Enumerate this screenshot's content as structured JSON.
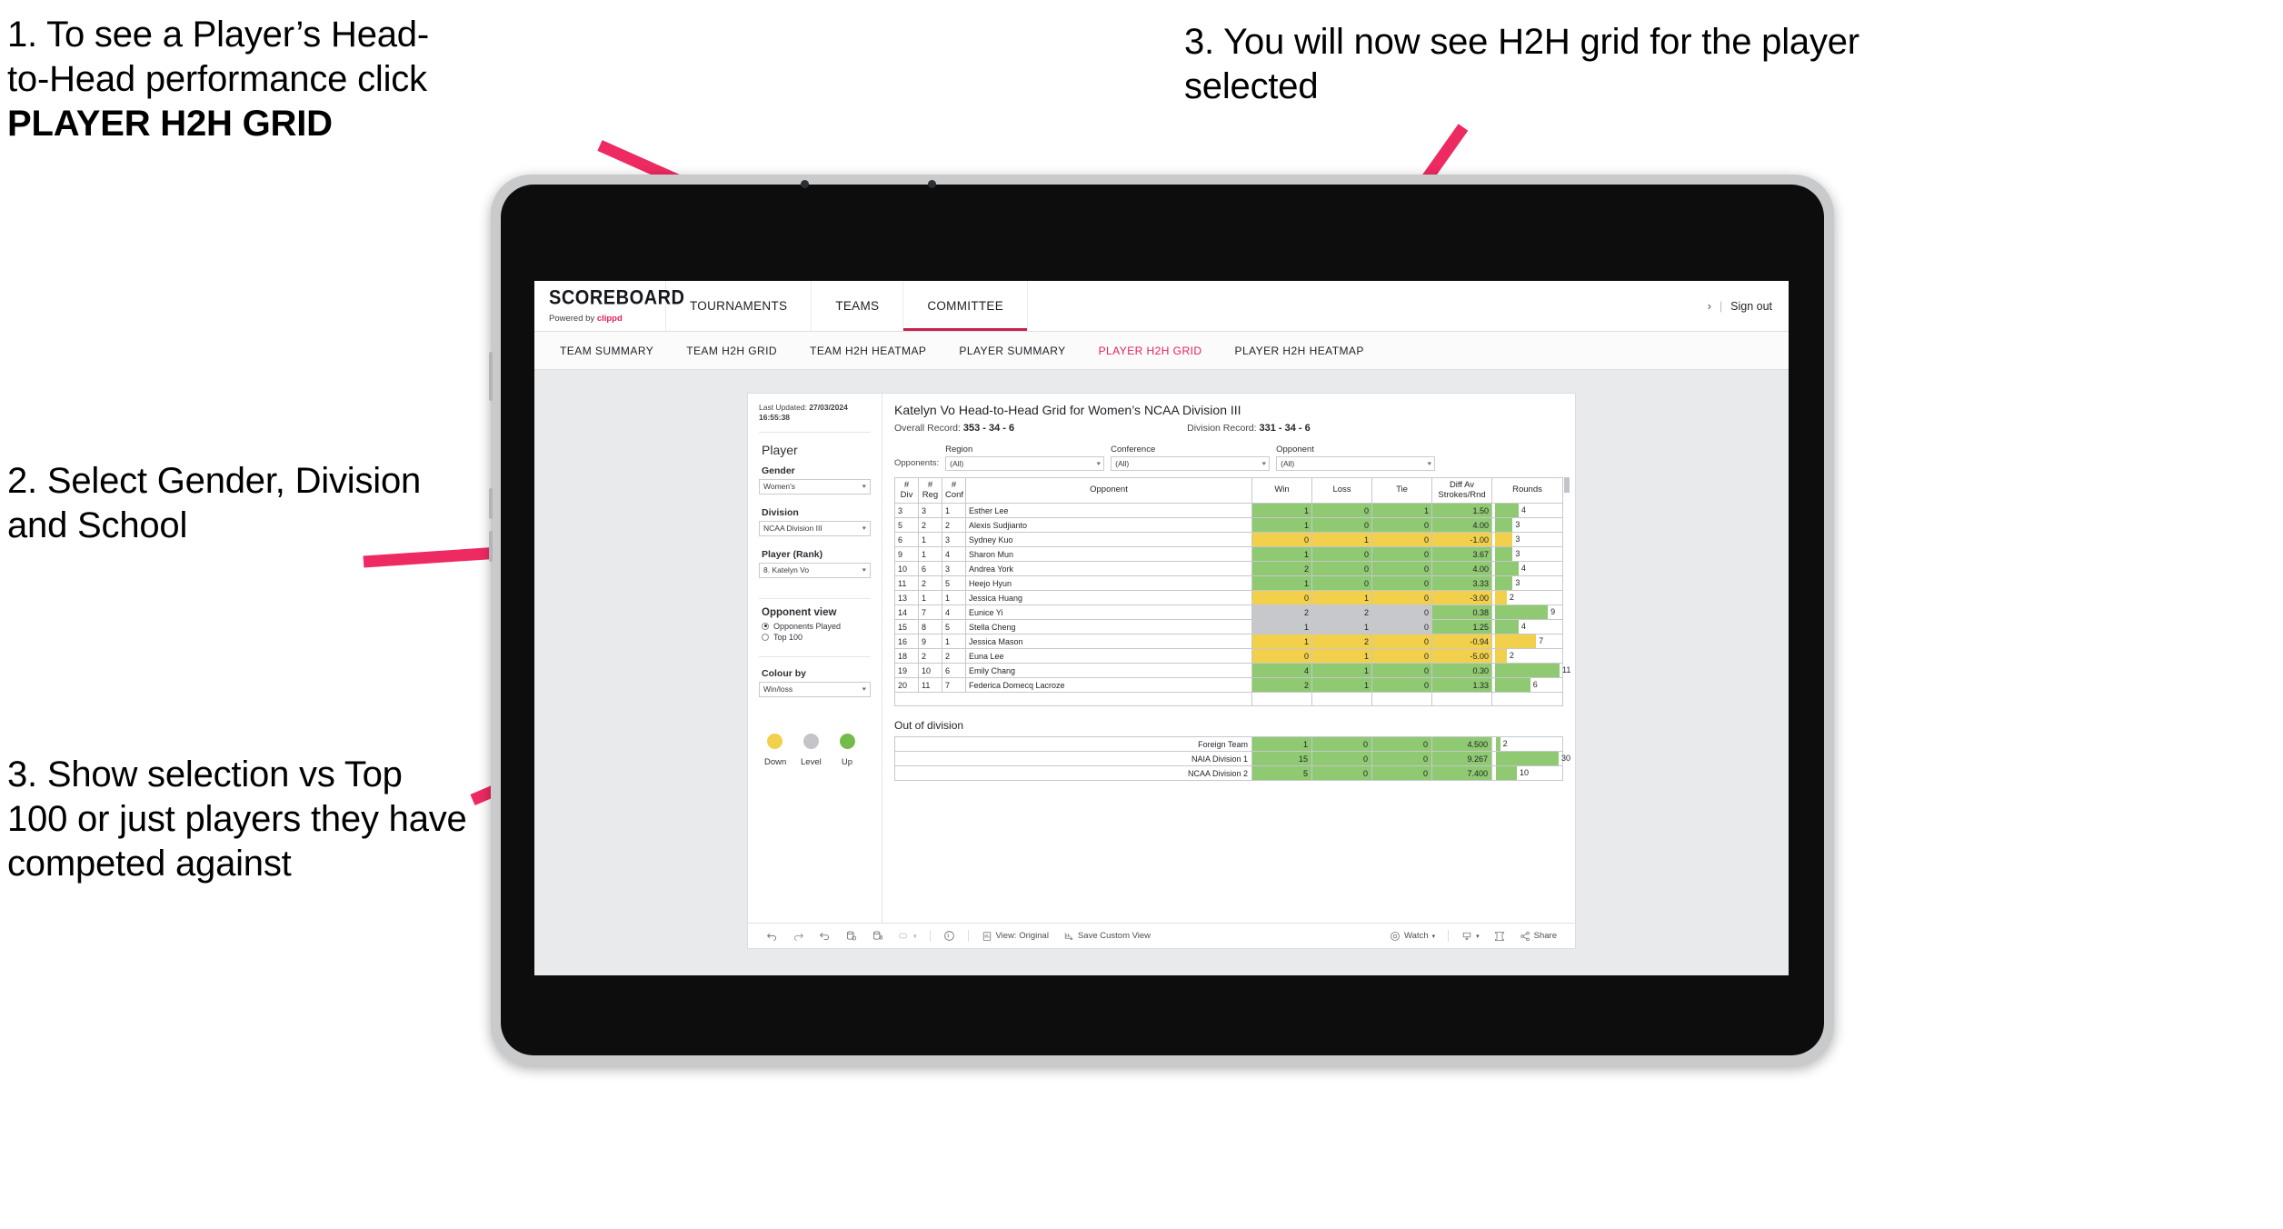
{
  "annotations": [
    {
      "id": "anno-1",
      "line1": "1. To see a Player’s Head-",
      "line2": "to-Head performance click",
      "bold": "PLAYER H2H GRID"
    },
    {
      "id": "anno-2",
      "text": "2. Select Gender, Division and School"
    },
    {
      "id": "anno-3",
      "text": "3. Show selection vs Top 100 or just players they have competed against"
    },
    {
      "id": "anno-4",
      "text": "3. You will now see H2H grid for the player selected"
    }
  ],
  "colors": {
    "accent": "#e8205a",
    "arrow": "#ee2a62",
    "green": "#8fc971",
    "yellow": "#f2d04b",
    "grey": "#c6c8cb",
    "bezel": "#c9cacb"
  },
  "app": {
    "brand": {
      "title": "SCOREBOARD",
      "powered_prefix": "Powered by ",
      "powered_brand": "clippd"
    },
    "topnav": [
      {
        "label": "TOURNAMENTS",
        "active": false
      },
      {
        "label": "TEAMS",
        "active": false
      },
      {
        "label": "COMMITTEE",
        "active": true
      }
    ],
    "topbar_right": {
      "chevron": "›",
      "divider": "|",
      "signout": "Sign out"
    },
    "subnav": [
      {
        "label": "TEAM SUMMARY",
        "active": false
      },
      {
        "label": "TEAM H2H GRID",
        "active": false
      },
      {
        "label": "TEAM H2H HEATMAP",
        "active": false
      },
      {
        "label": "PLAYER SUMMARY",
        "active": false
      },
      {
        "label": "PLAYER H2H GRID",
        "active": true
      },
      {
        "label": "PLAYER H2H HEATMAP",
        "active": false
      }
    ]
  },
  "pane": {
    "last_updated_label": "Last Updated: ",
    "last_updated_value": "27/03/2024 16:55:38",
    "heading": "Player",
    "filters": [
      {
        "label": "Gender",
        "value": "Women's"
      },
      {
        "label": "Division",
        "value": "NCAA Division III"
      },
      {
        "label": "Player (Rank)",
        "value": "8. Katelyn Vo"
      }
    ],
    "opponent_view": {
      "heading": "Opponent view",
      "options": [
        {
          "label": "Opponents Played",
          "selected": true
        },
        {
          "label": "Top 100",
          "selected": false
        }
      ]
    },
    "colour_by": {
      "label": "Colour by",
      "value": "Win/loss"
    },
    "legend": [
      {
        "label": "Down",
        "color": "#f2d04b"
      },
      {
        "label": "Level",
        "color": "#c3c5c8"
      },
      {
        "label": "Up",
        "color": "#74bb4e"
      }
    ]
  },
  "main": {
    "title": "Katelyn Vo Head-to-Head Grid for Women’s NCAA Division III",
    "overall_record_label": "Overall Record: ",
    "overall_record_value": "353 -  34 - 6",
    "division_record_label": "Division Record: ",
    "division_record_value": "331 -  34 - 6",
    "opponents_label": "Opponents:",
    "opponent_filters": [
      {
        "label": "Region",
        "value": "(All)"
      },
      {
        "label": "Conference",
        "value": "(All)"
      },
      {
        "label": "Opponent",
        "value": "(All)"
      }
    ],
    "out_of_division_title": "Out of division"
  },
  "chart_data": {
    "type": "table",
    "title": "Katelyn Vo Head-to-Head Grid for Women’s NCAA Division III",
    "columns": [
      "# Div",
      "# Reg",
      "# Conf",
      "Opponent",
      "Win",
      "Loss",
      "Tie",
      "Diff Av Strokes/Rnd",
      "Rounds"
    ],
    "column_headers_two_line": [
      {
        "l1": "#",
        "l2": "Div"
      },
      {
        "l1": "#",
        "l2": "Reg"
      },
      {
        "l1": "#",
        "l2": "Conf"
      },
      {
        "l1": "Opponent",
        "l2": ""
      },
      {
        "l1": "Win",
        "l2": ""
      },
      {
        "l1": "Loss",
        "l2": ""
      },
      {
        "l1": "Tie",
        "l2": ""
      },
      {
        "l1": "Diff Av",
        "l2": "Strokes/Rnd"
      },
      {
        "l1": "Rounds",
        "l2": ""
      }
    ],
    "rows_max_rounds": 11,
    "rows": [
      {
        "div": "3",
        "reg": "3",
        "conf": "1",
        "opponent": "Esther Lee",
        "win": "1",
        "loss": "0",
        "tie": "1",
        "diff": "1.50",
        "rounds": "4",
        "rounds_n": 4,
        "status": "up"
      },
      {
        "div": "5",
        "reg": "2",
        "conf": "2",
        "opponent": "Alexis Sudjianto",
        "win": "1",
        "loss": "0",
        "tie": "0",
        "diff": "4.00",
        "rounds": "3",
        "rounds_n": 3,
        "status": "up"
      },
      {
        "div": "6",
        "reg": "1",
        "conf": "3",
        "opponent": "Sydney Kuo",
        "win": "0",
        "loss": "1",
        "tie": "0",
        "diff": "-1.00",
        "rounds": "3",
        "rounds_n": 3,
        "status": "down"
      },
      {
        "div": "9",
        "reg": "1",
        "conf": "4",
        "opponent": "Sharon Mun",
        "win": "1",
        "loss": "0",
        "tie": "0",
        "diff": "3.67",
        "rounds": "3",
        "rounds_n": 3,
        "status": "up"
      },
      {
        "div": "10",
        "reg": "6",
        "conf": "3",
        "opponent": "Andrea York",
        "win": "2",
        "loss": "0",
        "tie": "0",
        "diff": "4.00",
        "rounds": "4",
        "rounds_n": 4,
        "status": "up"
      },
      {
        "div": "11",
        "reg": "2",
        "conf": "5",
        "opponent": "Heejo Hyun",
        "win": "1",
        "loss": "0",
        "tie": "0",
        "diff": "3.33",
        "rounds": "3",
        "rounds_n": 3,
        "status": "up"
      },
      {
        "div": "13",
        "reg": "1",
        "conf": "1",
        "opponent": "Jessica Huang",
        "win": "0",
        "loss": "1",
        "tie": "0",
        "diff": "-3.00",
        "rounds": "2",
        "rounds_n": 2,
        "status": "down"
      },
      {
        "div": "14",
        "reg": "7",
        "conf": "4",
        "opponent": "Eunice Yi",
        "win": "2",
        "loss": "2",
        "tie": "0",
        "diff": "0.38",
        "rounds": "9",
        "rounds_n": 9,
        "status": "level",
        "diff_status": "up"
      },
      {
        "div": "15",
        "reg": "8",
        "conf": "5",
        "opponent": "Stella Cheng",
        "win": "1",
        "loss": "1",
        "tie": "0",
        "diff": "1.25",
        "rounds": "4",
        "rounds_n": 4,
        "status": "level",
        "diff_status": "up"
      },
      {
        "div": "16",
        "reg": "9",
        "conf": "1",
        "opponent": "Jessica Mason",
        "win": "1",
        "loss": "2",
        "tie": "0",
        "diff": "-0.94",
        "rounds": "7",
        "rounds_n": 7,
        "status": "down"
      },
      {
        "div": "18",
        "reg": "2",
        "conf": "2",
        "opponent": "Euna Lee",
        "win": "0",
        "loss": "1",
        "tie": "0",
        "diff": "-5.00",
        "rounds": "2",
        "rounds_n": 2,
        "status": "down"
      },
      {
        "div": "19",
        "reg": "10",
        "conf": "6",
        "opponent": "Emily Chang",
        "win": "4",
        "loss": "1",
        "tie": "0",
        "diff": "0.30",
        "rounds": "11",
        "rounds_n": 11,
        "status": "up"
      },
      {
        "div": "20",
        "reg": "11",
        "conf": "7",
        "opponent": "Federica Domecq Lacroze",
        "win": "2",
        "loss": "1",
        "tie": "0",
        "diff": "1.33",
        "rounds": "6",
        "rounds_n": 6,
        "status": "up"
      }
    ],
    "out_of_division_max_rounds": 30,
    "out_of_division": [
      {
        "name": "Foreign Team",
        "win": "1",
        "loss": "0",
        "tie": "0",
        "diff": "4.500",
        "rounds": "2",
        "rounds_n": 2,
        "status": "up"
      },
      {
        "name": "NAIA Division 1",
        "win": "15",
        "loss": "0",
        "tie": "0",
        "diff": "9.267",
        "rounds": "30",
        "rounds_n": 30,
        "status": "up"
      },
      {
        "name": "NCAA Division 2",
        "win": "5",
        "loss": "0",
        "tie": "0",
        "diff": "7.400",
        "rounds": "10",
        "rounds_n": 10,
        "status": "up"
      }
    ]
  },
  "footer": {
    "undo": "undo-icon",
    "redo": "redo-icon",
    "revert": "revert-icon",
    "refresh": "refresh-data-icon",
    "pause": "pause-auto-updates-icon",
    "view_original": "View: Original",
    "save_custom_view": "Save Custom View",
    "watch": "Watch",
    "share": "Share"
  }
}
